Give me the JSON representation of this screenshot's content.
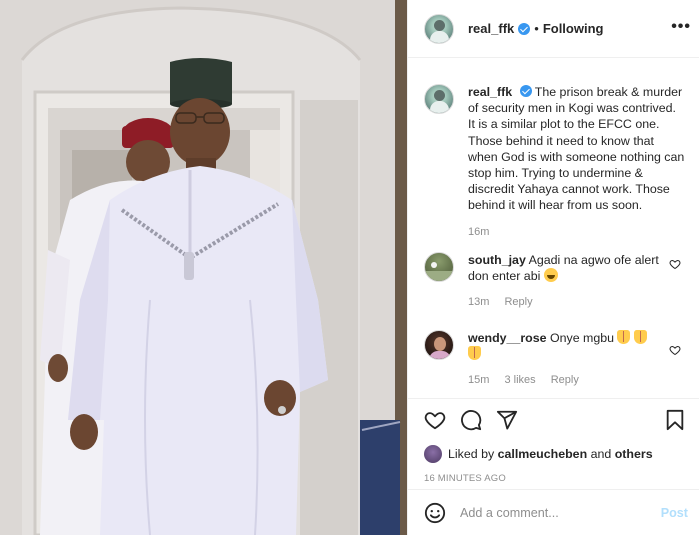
{
  "post": {
    "username": "real_ffk",
    "follow_status": "Following",
    "separator": "•",
    "more_label": "•••"
  },
  "caption": {
    "username": "real_ffk",
    "text": "The prison break & murder of security men in Kogi was contrived. It is a similar plot to the EFCC one. Those behind it need to know that when God is with someone nothing can stop him. Trying to undermine & discredit Yahaya cannot work. Those behind it will hear from us soon.",
    "time": "16m"
  },
  "comments": [
    {
      "username": "south_jay",
      "text": "Agadi na agwo ofe alert don enter abi",
      "emoji": "laughing-emoji",
      "time": "13m",
      "reply_label": "Reply"
    },
    {
      "username": "wendy__rose",
      "text": "Onye mgbu",
      "emoji": "praying-hands-emoji",
      "time": "15m",
      "likes": "3 likes",
      "reply_label": "Reply"
    }
  ],
  "likes": {
    "prefix": "Liked by",
    "user": "callmeucheben",
    "conjunction": "and",
    "others": "others"
  },
  "timestamp": "16 MINUTES AGO",
  "add_comment": {
    "placeholder": "Add a comment...",
    "post_label": "Post"
  },
  "colors": {
    "verified": "#3897f0",
    "post_disabled": "#b2dffc",
    "robe": "#e9e8f6",
    "cap": "#2f3b33",
    "red_cap": "#8e1c26"
  },
  "icons": [
    "heart-icon",
    "comment-icon",
    "share-icon",
    "bookmark-icon",
    "emoji-icon",
    "verified-badge-icon"
  ]
}
